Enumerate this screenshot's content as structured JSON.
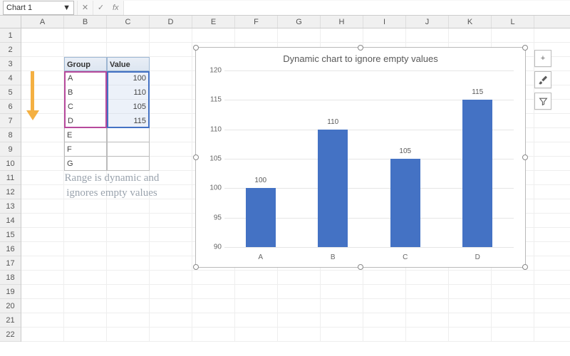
{
  "name_box": "Chart 1",
  "columns": [
    "A",
    "B",
    "C",
    "D",
    "E",
    "F",
    "G",
    "H",
    "I",
    "J",
    "K",
    "L"
  ],
  "rows": [
    "1",
    "2",
    "3",
    "4",
    "5",
    "6",
    "7",
    "8",
    "9",
    "10",
    "11",
    "12",
    "13",
    "14",
    "15",
    "16",
    "17",
    "18",
    "19",
    "20",
    "21",
    "22"
  ],
  "table": {
    "headers": {
      "group": "Group",
      "value": "Value"
    },
    "rows": [
      {
        "group": "A",
        "value": "100"
      },
      {
        "group": "B",
        "value": "110"
      },
      {
        "group": "C",
        "value": "105"
      },
      {
        "group": "D",
        "value": "115"
      },
      {
        "group": "E",
        "value": ""
      },
      {
        "group": "F",
        "value": ""
      },
      {
        "group": "G",
        "value": ""
      }
    ]
  },
  "note_text": "Range is dynamic and ignores empty values",
  "chart_data": {
    "type": "bar",
    "title": "Dynamic chart to ignore empty values",
    "categories": [
      "A",
      "B",
      "C",
      "D"
    ],
    "values": [
      100,
      110,
      105,
      115
    ],
    "ylim": [
      90,
      120
    ],
    "yticks": [
      90,
      95,
      100,
      105,
      110,
      115,
      120
    ],
    "xlabel": "",
    "ylabel": ""
  },
  "side_buttons": {
    "add": "+",
    "style": "brush-icon",
    "filter": "funnel-icon"
  }
}
